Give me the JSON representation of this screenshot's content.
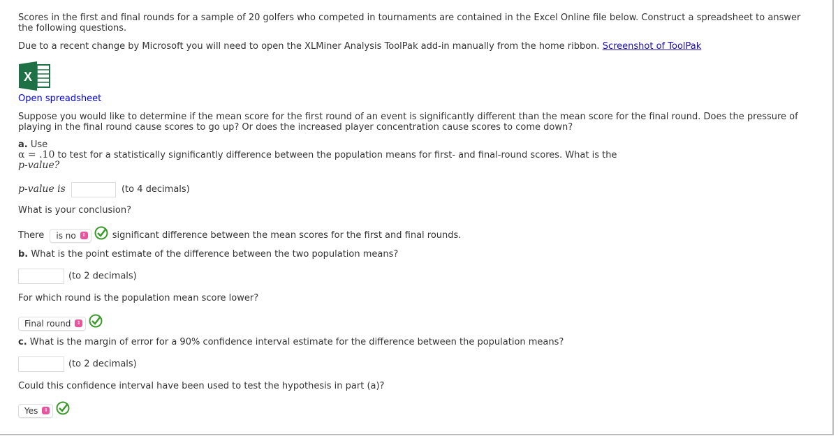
{
  "intro": "Scores in the first and final rounds for a sample of 20 golfers who competed in tournaments are contained in the Excel Online file below. Construct a spreadsheet to answer the following questions.",
  "notice": "Due to a recent change by Microsoft you will need to open the XLMiner Analysis ToolPak add-in manually from the home ribbon.",
  "notice_link": "Screenshot of ToolPak",
  "excel_icon": "excel-icon",
  "open_link": "Open spreadsheet",
  "scenario": "Suppose you would like to determine if the mean score for the first round of an event is significantly different than the mean score for the final round. Does the pressure of playing in the final round cause scores to go up? Or does the increased player concentration cause scores to come down?",
  "a": {
    "label": "a.",
    "use": "Use",
    "alpha": "α = .10",
    "text": "to test for a statistically significantly difference between the population means for first- and final-round scores. What is the",
    "pvalue_q": "p-value?",
    "pvalue_label": "p-value is",
    "pvalue_value": "",
    "pvalue_hint": "(to 4 decimals)",
    "conclusion_q": "What is your conclusion?",
    "there": "There",
    "select": "is no",
    "after": "significant difference between the mean scores for the first and final rounds."
  },
  "b": {
    "label": "b.",
    "question": "What is the point estimate of the difference between the two population means?",
    "value": "",
    "hint": "(to 2 decimals)",
    "lower_q": "For which round is the population mean score lower?",
    "select": "Final round"
  },
  "c": {
    "label": "c.",
    "question": "What is the margin of error for a 90% confidence interval estimate for the difference between the population means?",
    "value": "",
    "hint": "(to 2 decimals)",
    "test_q": "Could this confidence interval have been used to test the hypothesis in part (a)?",
    "select": "Yes"
  },
  "colors": {
    "check": "#3a9a2a",
    "select_arrow": "#e8539b",
    "link": "#0000ee",
    "excel": "#1e7145"
  }
}
